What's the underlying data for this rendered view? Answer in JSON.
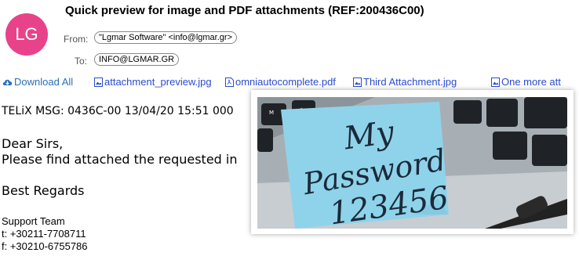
{
  "email": {
    "avatar_initials": "LG",
    "subject": "Quick preview for image and PDF attachments (REF:200436C00)",
    "from_label": "From:",
    "from_value": "\"Lgmar Software\" <info@lgmar.gr>",
    "to_label": "To:",
    "to_value": "INFO@LGMAR.GR"
  },
  "attachments": {
    "download_all": "Download All",
    "items": [
      {
        "name": "attachment_preview.jpg",
        "icon": "image-file-icon"
      },
      {
        "name": "omniautocomplete.pdf",
        "icon": "pdf-file-icon"
      },
      {
        "name": "Third Attachment.jpg",
        "icon": "image-file-icon"
      },
      {
        "name": "One more att",
        "icon": "image-file-icon"
      }
    ]
  },
  "body": {
    "line1": "TELiX MSG: 0436C-00 13/04/20 15:51 000",
    "line2": "Dear Sirs,",
    "line3": "Please find attached the requested in",
    "line4": "Best Regards"
  },
  "signature": {
    "team": "Support Team",
    "phone": "t: +30211-7708711",
    "fax": "f: +30210-6755786"
  },
  "preview": {
    "note_line1": "My",
    "note_line2": "Password",
    "note_line3": "123456"
  },
  "colors": {
    "avatar": "#e8438a",
    "link": "#2a4bd0",
    "note": "#8fd3ea"
  }
}
